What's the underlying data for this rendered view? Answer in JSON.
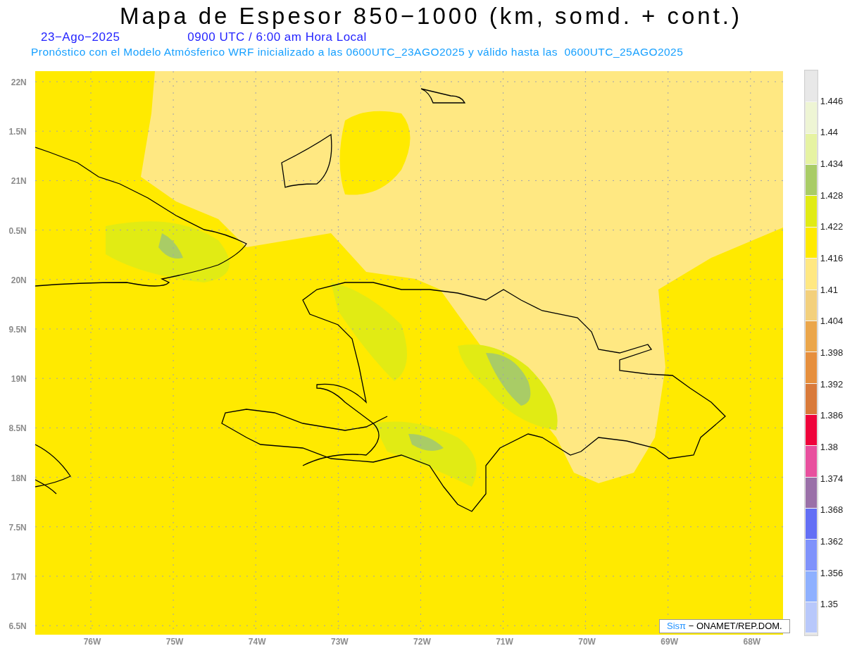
{
  "title": "Mapa de Espesor 850−1000 (km, somd. + cont.)",
  "date": "23−Ago−2025",
  "time": "0900 UTC / 6:00 am Hora Local",
  "subtitle": "Pronóstico con el Modelo Atmósferico WRF inicializado a las 0600UTC_23AGO2025 y válido hasta las  0600UTC_25AGO2025",
  "y_axis": [
    "22N",
    "1.5N",
    "21N",
    "0.5N",
    "20N",
    "9.5N",
    "19N",
    "8.5N",
    "18N",
    "7.5N",
    "17N",
    "6.5N"
  ],
  "x_axis": [
    "76W",
    "75W",
    "74W",
    "73W",
    "72W",
    "71W",
    "70W",
    "69W",
    "68W"
  ],
  "credit": {
    "brand": "Sisπ",
    "text": "− ONAMET/REP.DOM."
  },
  "colorbar": [
    {
      "color": "#e8e8e8",
      "label": "1.446"
    },
    {
      "color": "#eef5d4",
      "label": "1.44"
    },
    {
      "color": "#e6f3a2",
      "label": "1.434"
    },
    {
      "color": "#a9cc66",
      "label": "1.428"
    },
    {
      "color": "#e1eb14",
      "label": "1.422"
    },
    {
      "color": "#ffea00",
      "label": "1.416"
    },
    {
      "color": "#ffe882",
      "label": "1.41"
    },
    {
      "color": "#f3d07c",
      "label": "1.404"
    },
    {
      "color": "#eba64a",
      "label": "1.398"
    },
    {
      "color": "#e68f3d",
      "label": "1.392"
    },
    {
      "color": "#d97a3a",
      "label": "1.386"
    },
    {
      "color": "#ef033b",
      "label": "1.38"
    },
    {
      "color": "#e8509e",
      "label": "1.374"
    },
    {
      "color": "#9a70a8",
      "label": "1.368"
    },
    {
      "color": "#636ff5",
      "label": "1.362"
    },
    {
      "color": "#7f92fb",
      "label": "1.356"
    },
    {
      "color": "#8eb0ff",
      "label": "1.35"
    },
    {
      "color": "#b8c8fb"
    }
  ]
}
